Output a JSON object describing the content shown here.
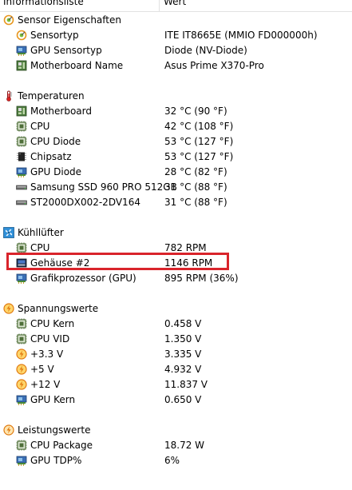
{
  "columns": {
    "field": "Informationsliste",
    "value": "Wert"
  },
  "sections": [
    {
      "title": "Sensor Eigenschaften",
      "icon": "sensor-icon",
      "items": [
        {
          "label": "Sensortyp",
          "value": "ITE IT8665E  (MMIO FD000000h)",
          "icon": "sensor-icon"
        },
        {
          "label": "GPU Sensortyp",
          "value": "Diode  (NV-Diode)",
          "icon": "gpu-icon"
        },
        {
          "label": "Motherboard Name",
          "value": "Asus Prime X370-Pro",
          "icon": "motherboard-icon"
        }
      ]
    },
    {
      "title": "Temperaturen",
      "icon": "thermometer-icon",
      "items": [
        {
          "label": "Motherboard",
          "value": "32 °C  (90 °F)",
          "icon": "motherboard-icon"
        },
        {
          "label": "CPU",
          "value": "42 °C  (108 °F)",
          "icon": "cpu-icon"
        },
        {
          "label": "CPU Diode",
          "value": "53 °C  (127 °F)",
          "icon": "cpu-icon"
        },
        {
          "label": "Chipsatz",
          "value": "53 °C  (127 °F)",
          "icon": "chip-icon"
        },
        {
          "label": "GPU Diode",
          "value": "28 °C  (82 °F)",
          "icon": "gpu-icon"
        },
        {
          "label": "Samsung SSD 960 PRO 512GB",
          "value": "31 °C  (88 °F)",
          "icon": "drive-icon"
        },
        {
          "label": "ST2000DX002-2DV164",
          "value": "31 °C  (88 °F)",
          "icon": "drive-icon"
        }
      ]
    },
    {
      "title": "Kühllüfter",
      "icon": "fan-icon",
      "items": [
        {
          "label": "CPU",
          "value": "782 RPM",
          "icon": "cpu-icon"
        },
        {
          "label": "Gehäuse #2",
          "value": "1146 RPM",
          "icon": "case-icon"
        },
        {
          "label": "Grafikprozessor (GPU)",
          "value": "895 RPM  (36%)",
          "icon": "gpu-icon"
        }
      ]
    },
    {
      "title": "Spannungswerte",
      "icon": "voltage-icon",
      "items": [
        {
          "label": "CPU Kern",
          "value": "0.458 V",
          "icon": "cpu-icon"
        },
        {
          "label": "CPU VID",
          "value": "1.350 V",
          "icon": "cpu-icon"
        },
        {
          "label": "+3.3 V",
          "value": "3.335 V",
          "icon": "voltage-icon"
        },
        {
          "label": "+5 V",
          "value": "4.932 V",
          "icon": "voltage-icon"
        },
        {
          "label": "+12 V",
          "value": "11.837 V",
          "icon": "voltage-icon"
        },
        {
          "label": "GPU Kern",
          "value": "0.650 V",
          "icon": "gpu-icon"
        }
      ]
    },
    {
      "title": "Leistungswerte",
      "icon": "power-icon",
      "items": [
        {
          "label": "CPU Package",
          "value": "18.72 W",
          "icon": "cpu-icon"
        },
        {
          "label": "GPU TDP%",
          "value": "6%",
          "icon": "gpu-icon"
        }
      ]
    }
  ],
  "colors": {
    "highlight": "#d9242b",
    "accent_orange": "#e8961e",
    "fan_blue": "#2f8fd8",
    "cpu_green": "#4f6f3a"
  }
}
